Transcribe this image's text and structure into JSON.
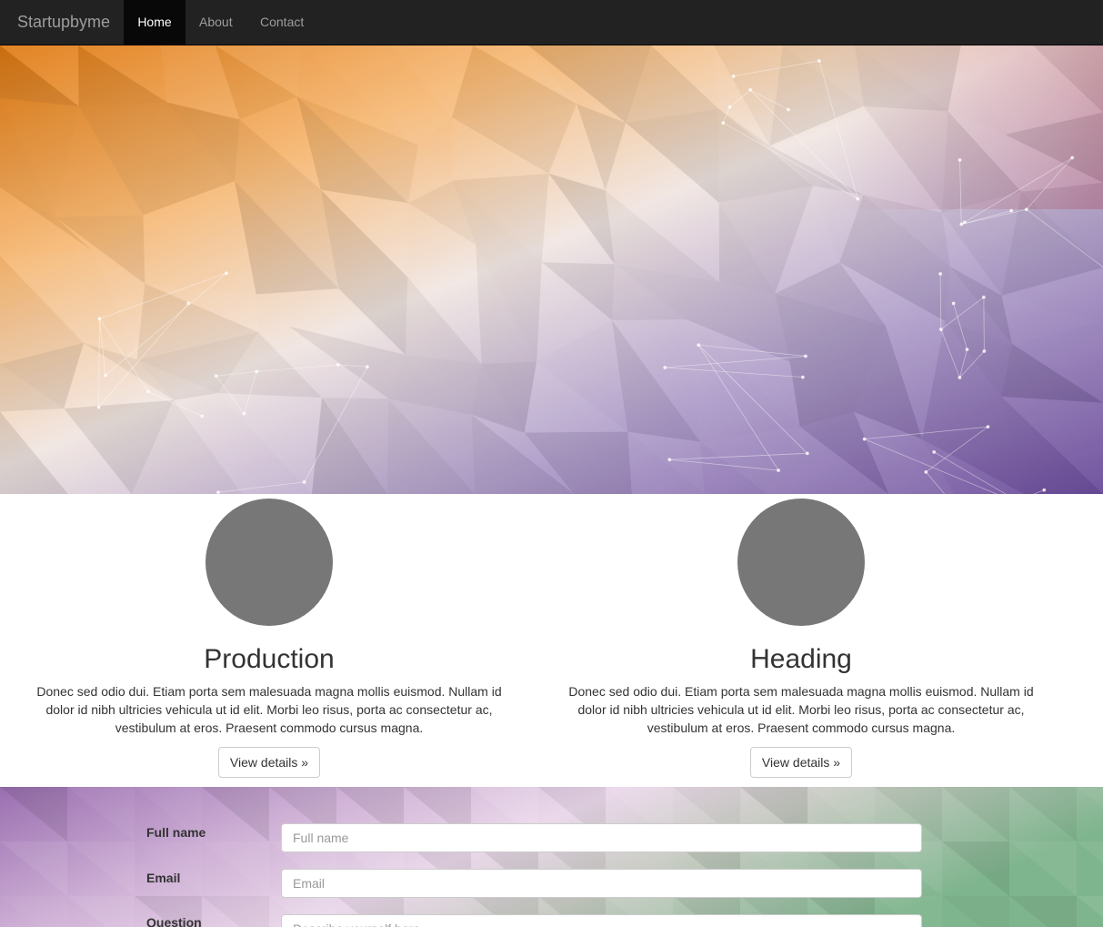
{
  "navbar": {
    "brand": "Startupbyme",
    "items": [
      {
        "label": "Home"
      },
      {
        "label": "About"
      },
      {
        "label": "Contact"
      }
    ]
  },
  "features": [
    {
      "heading": "Production",
      "text": "Donec sed odio dui. Etiam porta sem malesuada magna mollis euismod. Nullam id dolor id nibh ultricies vehicula ut id elit. Morbi leo risus, porta ac consectetur ac, vestibulum at eros. Praesent commodo cursus magna.",
      "button": "View details »"
    },
    {
      "heading": "Heading",
      "text": "Donec sed odio dui. Etiam porta sem malesuada magna mollis euismod. Nullam id dolor id nibh ultricies vehicula ut id elit. Morbi leo risus, porta ac consectetur ac, vestibulum at eros. Praesent commodo cursus magna.",
      "button": "View details »"
    }
  ],
  "form": {
    "fields": [
      {
        "label": "Full name",
        "placeholder": "Full name",
        "value": ""
      },
      {
        "label": "Email",
        "placeholder": "Email",
        "value": ""
      },
      {
        "label": "Question",
        "placeholder": "Describe yourself here...",
        "value": ""
      }
    ]
  },
  "colors": {
    "navbar": "#222222",
    "hero_orange": "#e8892a",
    "hero_light": "#f3ece6",
    "hero_purple": "#7a5aa6",
    "form_purple": "#a57cba",
    "form_green": "#8fbf94"
  }
}
